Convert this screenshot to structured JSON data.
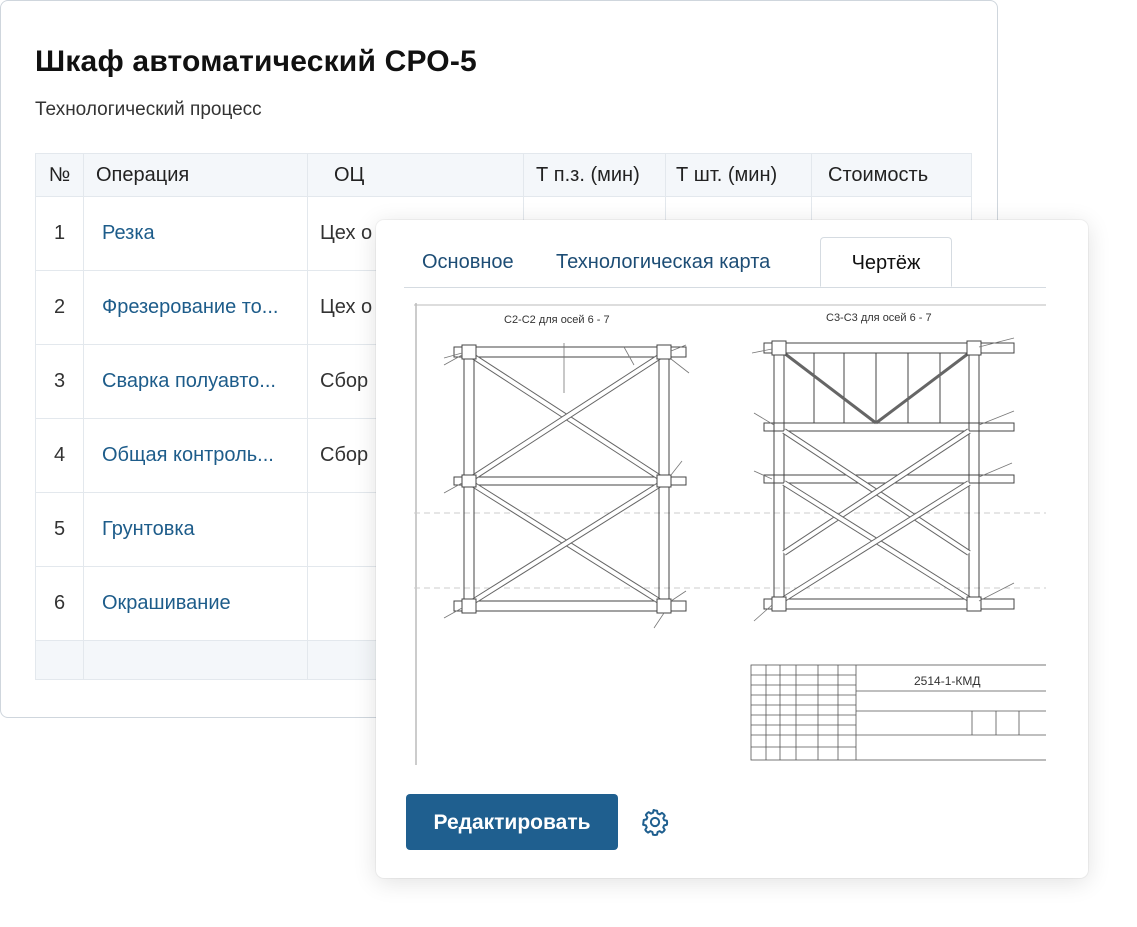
{
  "back": {
    "title": "Шкаф автоматический СРО-5",
    "subtitle": "Технологический процесс",
    "columns": [
      "№",
      "Операция",
      "ОЦ",
      "Т п.з. (мин)",
      "Т шт. (мин)",
      "Стоимость"
    ],
    "rows": [
      {
        "num": "1",
        "op": "Резка",
        "oc": "Цех о"
      },
      {
        "num": "2",
        "op": "Фрезерование то...",
        "oc": "Цех о"
      },
      {
        "num": "3",
        "op": "Сварка полуавто...",
        "oc": "Сбор"
      },
      {
        "num": "4",
        "op": "Общая контроль...",
        "oc": "Сбор"
      },
      {
        "num": "5",
        "op": "Грунтовка",
        "oc": ""
      },
      {
        "num": "6",
        "op": "Окрашивание",
        "oc": ""
      }
    ]
  },
  "front": {
    "tabs": [
      "Основное",
      "Технологическая карта",
      "Чертёж"
    ],
    "active_tab": "Чертёж",
    "drawing": {
      "left_title": "С2-С2 для осей 6 - 7",
      "right_title": "С3-С3 для осей 6 - 7",
      "stamp_code": "2514-1-КМД"
    },
    "edit_label": "Редактировать",
    "gear_icon": "gear-icon"
  },
  "colors": {
    "accent": "#1f5f8f",
    "link": "#1d5c8a",
    "tab_text": "#1d4d75"
  }
}
